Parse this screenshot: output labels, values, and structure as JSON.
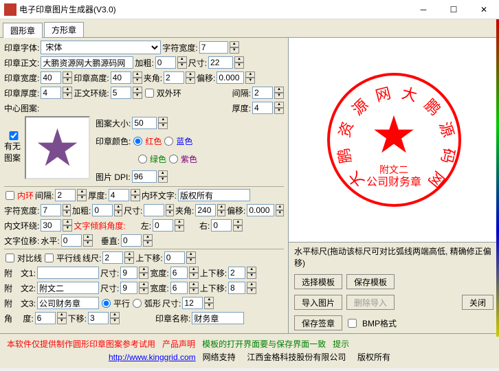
{
  "window": {
    "title": "电子印章图片生成器(V3.0)"
  },
  "tabs": {
    "round": "圆形章",
    "square": "方形章"
  },
  "labels": {
    "font": "印章字体:",
    "charWidth": "字符宽度:",
    "mainText": "印章正文:",
    "bold": "加粗:",
    "size": "尺寸:",
    "sealWidth": "印章宽度:",
    "sealHeight": "印章高度:",
    "angle": "夹角:",
    "offset": "偏移:",
    "thickness": "印章厚度:",
    "textRing": "正文环绕:",
    "doubleRing": "双外环",
    "gap": "间隔:",
    "thick2": "厚度:",
    "centerPattern": "中心图案:",
    "hasPattern": "有无图案",
    "patternSize": "图案大小:",
    "sealColor": "印章颜色:",
    "red": "红色",
    "blue": "蓝色",
    "green": "绿色",
    "purple": "紫色",
    "dpi": "图片 DPI:",
    "innerRing": "内环",
    "innerGap": "间隔:",
    "innerThick": "厚度:",
    "innerText": "内环文字:",
    "charW2": "字符宽度:",
    "bold2": "加粗:",
    "size2": "尺寸:",
    "angle2": "夹角:",
    "offset2": "偏移:",
    "innerTextRing": "内文环绕:",
    "tiltAngle": "文字倾斜角度:",
    "left": "左:",
    "rightL": "右:",
    "textPos": "文字位移:",
    "horiz": "水平:",
    "vert": "垂直:",
    "diagLine": "对比线",
    "paraLine": "平行线",
    "lineSize": "线尺:",
    "upDown": "上下移:",
    "attach1": "附　文1:",
    "attach2": "附　文2:",
    "attach3": "附　文3:",
    "size3": "尺寸:",
    "width": "宽度:",
    "flat": "平行",
    "arc": "弧形",
    "degree": "角　 度:",
    "downMove": "下移:",
    "sealName": "印章名称:",
    "rulerHint": "水平标尺(拖动该标尺可对比弧线两端高低, 精确修正偏移)",
    "bmpFormat": "BMP格式"
  },
  "values": {
    "font": "宋体",
    "charWidth": "7",
    "mainText": "大鹏资源网大鹏源码网",
    "bold": "0",
    "size": "22",
    "sealWidth": "40",
    "sealHeight": "40",
    "angle": "2",
    "offset": "0.000",
    "thickness": "4",
    "textRing": "5",
    "gap": "2",
    "thick2": "4",
    "patternSize": "50",
    "dpi": "96",
    "innerGap": "2",
    "innerThick": "4",
    "innerText": "版权所有",
    "charW2": "7",
    "bold2": "0",
    "size2": "",
    "angle2": "240",
    "offset2": "0.000",
    "innerTextRing": "30",
    "left": "0",
    "right": "0",
    "horiz": "0",
    "vert": "0",
    "lineSize": "2",
    "upDown": "0",
    "attach1": "",
    "a1size": "9",
    "a1width": "6",
    "a1ud": "2",
    "attach2": "附文二",
    "a2size": "9",
    "a2width": "6",
    "a2ud": "8",
    "attach3": "公司财务章",
    "a3size": "12",
    "degree": "6",
    "downMove": "3",
    "sealName": "财务章"
  },
  "buttons": {
    "selectTpl": "选择模板",
    "saveTpl": "保存模板",
    "importImg": "导入图片",
    "deleteImport": "删除导入",
    "close": "关闭",
    "saveSig": "保存签章"
  },
  "footer": {
    "disclaimer": "本软件仅提供制作圆形印章图案参考试用",
    "productNote": "产品声明",
    "tplHint": "模板的打开界面要与保存界面一致",
    "hint": "提示",
    "url": "http://www.kinggrid.com",
    "netSupport": "网络支持",
    "company": "江西金格科技股份有限公司",
    "copyright": "版权所有"
  },
  "seal": {
    "arcText": "大鹏资源网大鹏源码网",
    "line1": "附文二",
    "line2": "公司财务章"
  }
}
